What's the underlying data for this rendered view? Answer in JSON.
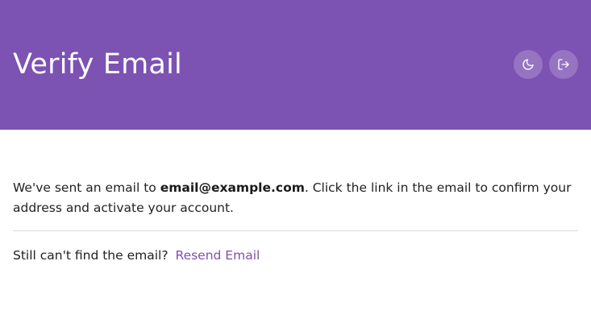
{
  "header": {
    "title": "Verify Email",
    "background_color": "#7c52b3",
    "actions": [
      {
        "name": "theme-toggle",
        "icon": "moon-icon"
      },
      {
        "name": "logout",
        "icon": "logout-icon"
      }
    ]
  },
  "message": {
    "prefix": "We've sent an email to ",
    "email": "email@example.com",
    "suffix": ". Click the link in the email to confirm your address and activate your account."
  },
  "resend": {
    "prompt": "Still can't find the email?",
    "link_label": "Resend Email",
    "link_color": "#7c52b3"
  }
}
